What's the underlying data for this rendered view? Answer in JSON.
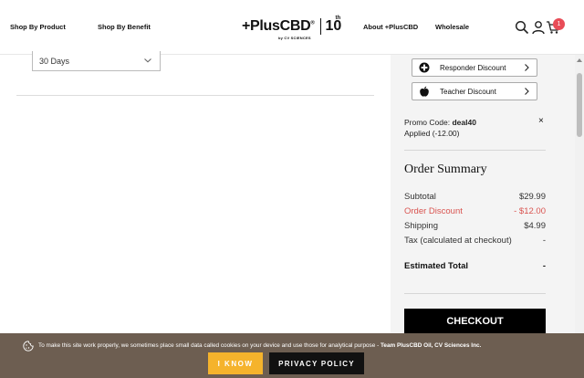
{
  "header": {
    "nav_left": [
      "Shop By Product",
      "Shop By Benefit"
    ],
    "logo_text": "+PlusCBD",
    "logo_reg": "®",
    "logo_sub": "by CV SCIENCES",
    "logo_badge": "10",
    "logo_badge_sup": "th",
    "nav_right": [
      "About +PlusCBD",
      "Wholesale"
    ],
    "cart_count": "1",
    "icons": [
      "search-icon",
      "user-icon",
      "cart-icon"
    ]
  },
  "subscription": {
    "interval_value": "30 Days"
  },
  "discounts": {
    "responder_label": "Responder Discount",
    "teacher_label": "Teacher Discount"
  },
  "promo": {
    "label": "Promo Code:",
    "code": "deal40",
    "applied": "Applied (-12.00)",
    "close": "×"
  },
  "summary": {
    "title": "Order Summary",
    "subtotal_label": "Subtotal",
    "subtotal_value": "$29.99",
    "discount_label": "Order Discount",
    "discount_value": "- $12.00",
    "shipping_label": "Shipping",
    "shipping_value": "$4.99",
    "tax_label": "Tax (calculated at checkout)",
    "tax_value": "-",
    "total_label": "Estimated Total",
    "total_value": "-",
    "checkout_label": "CHECKOUT"
  },
  "cookie": {
    "text": "To make this site work properly, we sometimes place small data called cookies on your device and use those for analytical purpose - ",
    "team": "Team PlusCBD Oil, CV Sciences Inc.",
    "accept_label": "I KNOW",
    "privacy_label": "PRIVACY POLICY"
  },
  "colors": {
    "accent_yellow": "#f5b32c",
    "discount_red": "#d9534f",
    "badge_red": "#e84c57",
    "banner_brown": "#6d5e51"
  }
}
